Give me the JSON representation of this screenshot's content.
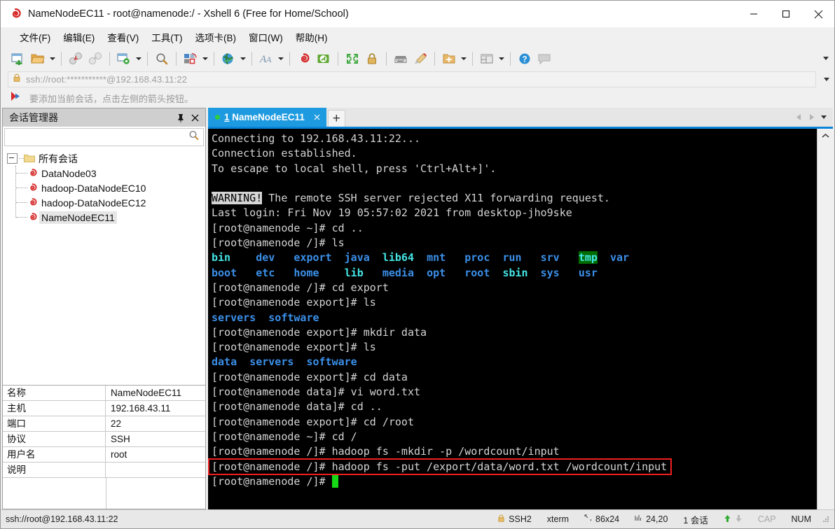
{
  "window": {
    "title": "NameNodeEC11 - root@namenode:/ - Xshell 6 (Free for Home/School)",
    "icon": "xshell-icon",
    "minimize_label": "—",
    "maximize_label": "□",
    "close_label": "✕"
  },
  "menubar": {
    "items": [
      {
        "label": "文件(F)",
        "name": "menu-file"
      },
      {
        "label": "编辑(E)",
        "name": "menu-edit"
      },
      {
        "label": "查看(V)",
        "name": "menu-view"
      },
      {
        "label": "工具(T)",
        "name": "menu-tools"
      },
      {
        "label": "选项卡(B)",
        "name": "menu-tabs"
      },
      {
        "label": "窗口(W)",
        "name": "menu-window"
      },
      {
        "label": "帮助(H)",
        "name": "menu-help"
      }
    ]
  },
  "toolbar": {
    "icons": [
      "new-session-icon",
      "open-folder-icon",
      "disconnect-icon",
      "reconnect-icon",
      "session-properties-icon",
      "find-icon",
      "transfer-file-icon",
      "globe-icon",
      "font-icon",
      "xshell-icon",
      "xftp-icon",
      "fullscreen-icon",
      "lock-icon",
      "keyboard-icon",
      "highlight-icon",
      "new-folder-icon",
      "arrange-icon",
      "help-icon",
      "comment-icon"
    ],
    "overflow_label": "more-toolbar-buttons"
  },
  "address_bar": {
    "value": "ssh://root:***********@192.168.43.11:22",
    "lock_icon": "lock-icon",
    "dropdown_icon": "chevron-down-icon"
  },
  "notice_bar": {
    "icon": "red-arrow-icon",
    "text": "要添加当前会话，点击左侧的箭头按钮。"
  },
  "session_manager": {
    "title": "会话管理器",
    "pin_icon": "pin-icon",
    "close_icon": "close-icon",
    "search": {
      "value": "",
      "placeholder": "",
      "icon": "search-icon"
    },
    "tree": {
      "root": {
        "label": "所有会话",
        "icon": "folder-icon",
        "expanded": true
      },
      "items": [
        {
          "label": "DataNode03",
          "icon": "xshell-session-icon",
          "selected": false
        },
        {
          "label": "hadoop-DataNodeEC10",
          "icon": "xshell-session-icon",
          "selected": false
        },
        {
          "label": "hadoop-DataNodeEC12",
          "icon": "xshell-session-icon",
          "selected": false
        },
        {
          "label": "NameNodeEC11",
          "icon": "xshell-session-icon",
          "selected": true
        }
      ]
    },
    "properties": [
      {
        "key": "名称",
        "value": "NameNodeEC11"
      },
      {
        "key": "主机",
        "value": "192.168.43.11"
      },
      {
        "key": "端口",
        "value": "22"
      },
      {
        "key": "协议",
        "value": "SSH"
      },
      {
        "key": "用户名",
        "value": "root"
      },
      {
        "key": "说明",
        "value": ""
      }
    ]
  },
  "tabs": {
    "active": {
      "number": "1",
      "label": "NameNodeEC11",
      "status_icon": "connected-dot",
      "close_icon": "close-icon"
    },
    "new_tab_label": "+",
    "nav_prev_icon": "triangle-left-icon",
    "nav_next_icon": "triangle-right-icon",
    "nav_menu_icon": "chevron-down-icon"
  },
  "terminal": {
    "scroll_up_icon": "chevron-up-icon",
    "prompt_root": "[root@namenode ~]# ",
    "lines": [
      {
        "segments": [
          {
            "t": "Connecting to 192.168.43.11:22...",
            "c": "c-white"
          }
        ]
      },
      {
        "segments": [
          {
            "t": "Connection established.",
            "c": "c-white"
          }
        ]
      },
      {
        "segments": [
          {
            "t": "To escape to local shell, press 'Ctrl+Alt+]'.",
            "c": "c-white"
          }
        ]
      },
      {
        "segments": [
          {
            "t": "",
            "c": "c-white"
          }
        ]
      },
      {
        "segments": [
          {
            "t": "WARNING!",
            "c": "inv"
          },
          {
            "t": " The remote SSH server rejected X11 forwarding request.",
            "c": "c-white"
          }
        ]
      },
      {
        "segments": [
          {
            "t": "Last login: Fri Nov 19 05:57:02 2021 from desktop-jho9ske",
            "c": "c-white"
          }
        ]
      },
      {
        "segments": [
          {
            "t": "[root@namenode ~]# cd ..",
            "c": "c-white"
          }
        ]
      },
      {
        "segments": [
          {
            "t": "[root@namenode /]# ls",
            "c": "c-white"
          }
        ]
      },
      {
        "segments": [
          {
            "t": "bin",
            "c": "c-cyan"
          },
          {
            "t": "    ",
            "c": "c-white"
          },
          {
            "t": "dev",
            "c": "c-blue"
          },
          {
            "t": "   ",
            "c": "c-white"
          },
          {
            "t": "export",
            "c": "c-blue"
          },
          {
            "t": "  ",
            "c": "c-white"
          },
          {
            "t": "java",
            "c": "c-blue"
          },
          {
            "t": "  ",
            "c": "c-white"
          },
          {
            "t": "lib64",
            "c": "c-cyan"
          },
          {
            "t": "  ",
            "c": "c-white"
          },
          {
            "t": "mnt",
            "c": "c-blue"
          },
          {
            "t": "   ",
            "c": "c-white"
          },
          {
            "t": "proc",
            "c": "c-blue"
          },
          {
            "t": "  ",
            "c": "c-white"
          },
          {
            "t": "run",
            "c": "c-blue"
          },
          {
            "t": "   ",
            "c": "c-white"
          },
          {
            "t": "srv",
            "c": "c-blue"
          },
          {
            "t": "   ",
            "c": "c-white"
          },
          {
            "t": "tmp",
            "c": "tmp"
          },
          {
            "t": "  ",
            "c": "c-white"
          },
          {
            "t": "var",
            "c": "c-blue"
          }
        ]
      },
      {
        "segments": [
          {
            "t": "boot",
            "c": "c-blue"
          },
          {
            "t": "   ",
            "c": "c-white"
          },
          {
            "t": "etc",
            "c": "c-blue"
          },
          {
            "t": "   ",
            "c": "c-white"
          },
          {
            "t": "home",
            "c": "c-blue"
          },
          {
            "t": "    ",
            "c": "c-white"
          },
          {
            "t": "lib",
            "c": "c-cyan"
          },
          {
            "t": "   ",
            "c": "c-white"
          },
          {
            "t": "media",
            "c": "c-blue"
          },
          {
            "t": "  ",
            "c": "c-white"
          },
          {
            "t": "opt",
            "c": "c-blue"
          },
          {
            "t": "   ",
            "c": "c-white"
          },
          {
            "t": "root",
            "c": "c-blue"
          },
          {
            "t": "  ",
            "c": "c-white"
          },
          {
            "t": "sbin",
            "c": "c-cyan"
          },
          {
            "t": "  ",
            "c": "c-white"
          },
          {
            "t": "sys",
            "c": "c-blue"
          },
          {
            "t": "   ",
            "c": "c-white"
          },
          {
            "t": "usr",
            "c": "c-blue"
          }
        ]
      },
      {
        "segments": [
          {
            "t": "[root@namenode /]# cd export",
            "c": "c-white"
          }
        ]
      },
      {
        "segments": [
          {
            "t": "[root@namenode export]# ls",
            "c": "c-white"
          }
        ]
      },
      {
        "segments": [
          {
            "t": "servers",
            "c": "c-blue"
          },
          {
            "t": "  ",
            "c": "c-white"
          },
          {
            "t": "software",
            "c": "c-blue"
          }
        ]
      },
      {
        "segments": [
          {
            "t": "[root@namenode export]# mkdir data",
            "c": "c-white"
          }
        ]
      },
      {
        "segments": [
          {
            "t": "[root@namenode export]# ls",
            "c": "c-white"
          }
        ]
      },
      {
        "segments": [
          {
            "t": "data",
            "c": "c-blue"
          },
          {
            "t": "  ",
            "c": "c-white"
          },
          {
            "t": "servers",
            "c": "c-blue"
          },
          {
            "t": "  ",
            "c": "c-white"
          },
          {
            "t": "software",
            "c": "c-blue"
          }
        ]
      },
      {
        "segments": [
          {
            "t": "[root@namenode export]# cd data",
            "c": "c-white"
          }
        ]
      },
      {
        "segments": [
          {
            "t": "[root@namenode data]# vi word.txt",
            "c": "c-white"
          }
        ]
      },
      {
        "segments": [
          {
            "t": "[root@namenode data]# cd ..",
            "c": "c-white"
          }
        ]
      },
      {
        "segments": [
          {
            "t": "[root@namenode export]# cd /root",
            "c": "c-white"
          }
        ]
      },
      {
        "segments": [
          {
            "t": "[root@namenode ~]# cd /",
            "c": "c-white"
          }
        ]
      },
      {
        "segments": [
          {
            "t": "[root@namenode /]# hadoop fs -mkdir -p /wordcount/input",
            "c": "c-white"
          }
        ]
      },
      {
        "segments": [
          {
            "t": "[root@namenode /]# hadoop fs -put /export/data/word.txt /wordcount/input",
            "c": "c-white"
          }
        ]
      },
      {
        "segments": [
          {
            "t": "[root@namenode /]# ",
            "c": "c-white"
          },
          {
            "t": " ",
            "c": "cursor"
          }
        ]
      }
    ],
    "highlight": {
      "name": "red-highlight-box",
      "color": "#ef2020",
      "line_index": 22,
      "text": "[root@namenode /]# hadoop fs -put /export/data/word.txt /wordcount/input"
    }
  },
  "status_bar": {
    "left": "ssh://root@192.168.43.11:22",
    "protocol": {
      "icon": "lock-icon",
      "label": "SSH2"
    },
    "terminal_type": "xterm",
    "size": {
      "icon": "resize-icon",
      "label": "86x24"
    },
    "cursor_pos": {
      "icon": "position-icon",
      "label": "24,20"
    },
    "sessions": "1 会话",
    "upload_icon": "arrow-up-icon",
    "download_icon": "arrow-down-icon",
    "cap": "CAP",
    "num": "NUM",
    "grip": "resize-grip"
  }
}
